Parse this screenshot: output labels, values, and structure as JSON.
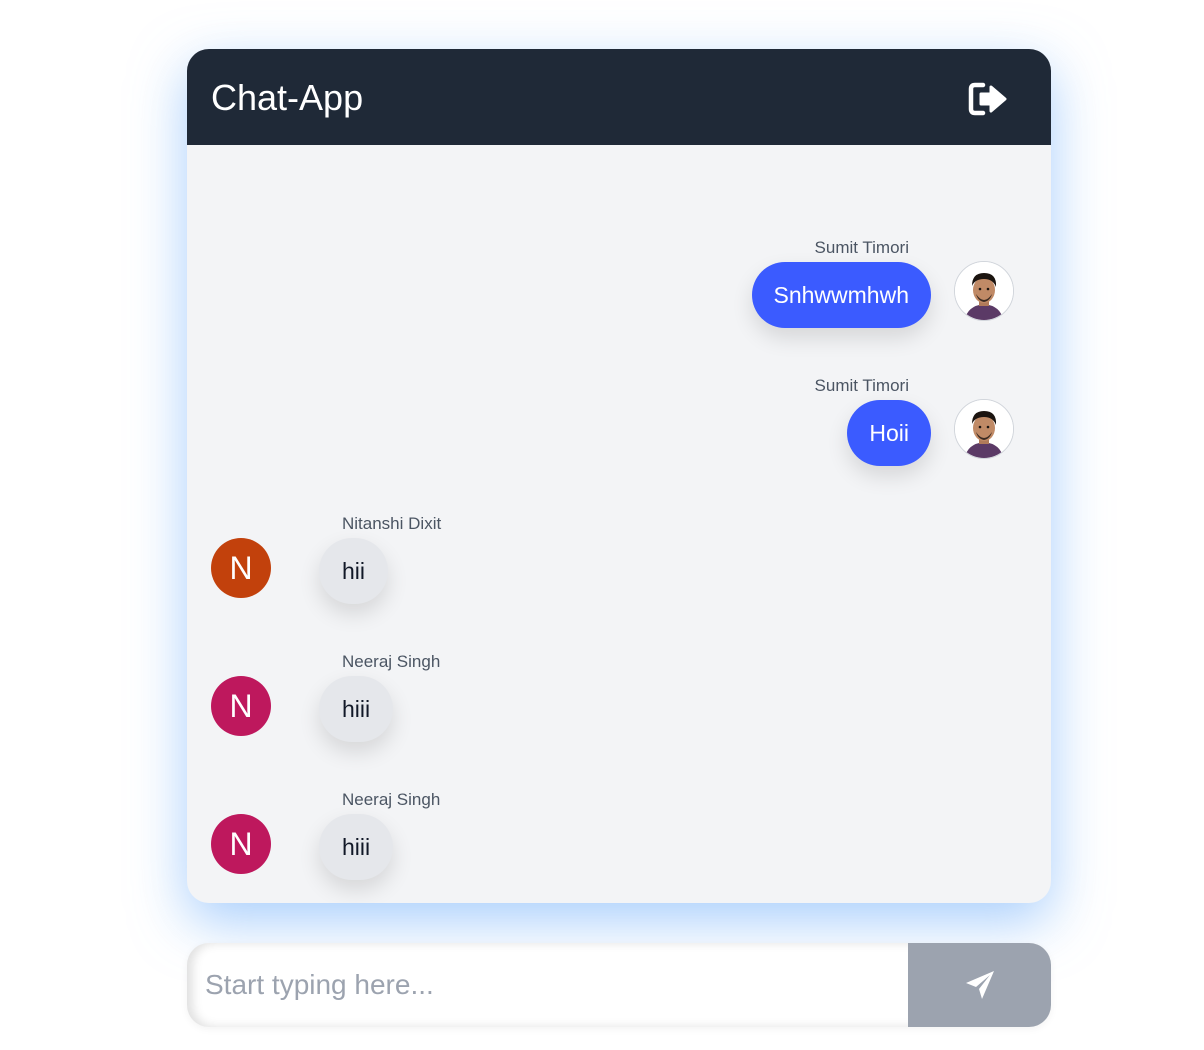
{
  "header": {
    "title": "Chat-App",
    "logout_icon": "logout-icon"
  },
  "messages": [
    {
      "sender": "Sumit Timori",
      "text": "Snhwwmhwh",
      "direction": "outgoing",
      "avatar": "photo"
    },
    {
      "sender": "Sumit Timori",
      "text": "Hoii",
      "direction": "outgoing",
      "avatar": "photo"
    },
    {
      "sender": "Nitanshi Dixit",
      "text": "hii",
      "direction": "incoming",
      "avatar_letter": "N",
      "avatar_color": "#c2410c"
    },
    {
      "sender": "Neeraj Singh",
      "text": "hiii",
      "direction": "incoming",
      "avatar_letter": "N",
      "avatar_color": "#be185d"
    },
    {
      "sender": "Neeraj Singh",
      "text": "hiii",
      "direction": "incoming",
      "avatar_letter": "N",
      "avatar_color": "#be185d"
    }
  ],
  "composer": {
    "placeholder": "Start typing here...",
    "value": "",
    "send_icon": "send-icon"
  },
  "colors": {
    "header_bg": "#1f2937",
    "outgoing_bubble": "#3b5bff",
    "incoming_bubble": "#e5e7eb",
    "send_button": "#9ca3af"
  }
}
